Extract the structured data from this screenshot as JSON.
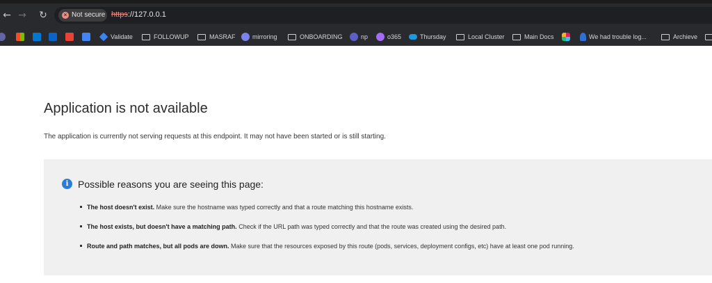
{
  "browser": {
    "security_chip": "Not secure",
    "url_scheme": "https",
    "url_rest": "://127.0.0.1",
    "bookmarks": [
      {
        "label": "",
        "icon": "teams-icon",
        "color": "#6264a7"
      },
      {
        "label": "",
        "icon": "windows-icon",
        "color": "#f25022"
      },
      {
        "label": "",
        "icon": "app-icon",
        "color": "#0078d4"
      },
      {
        "label": "",
        "icon": "outlook-icon",
        "color": "#0a64c8"
      },
      {
        "label": "",
        "icon": "gmail-icon",
        "color": "#ea4335"
      },
      {
        "label": "",
        "icon": "calendar-icon",
        "color": "#4285f4"
      },
      {
        "label": "Validate",
        "icon": "diamond-icon",
        "color": "#3b82f6"
      },
      {
        "label": "FOLLOWUP",
        "icon": "folder-icon",
        "color": ""
      },
      {
        "label": "MASRAF",
        "icon": "folder-icon",
        "color": ""
      },
      {
        "label": "mirroring",
        "icon": "teams-icon",
        "color": "#7b83eb"
      },
      {
        "label": "ONBOARDING",
        "icon": "folder-icon",
        "color": ""
      },
      {
        "label": "np",
        "icon": "teams-icon",
        "color": "#5b5fc7"
      },
      {
        "label": "o365",
        "icon": "copilot-icon",
        "color": "#a46cf5"
      },
      {
        "label": "Thursday",
        "icon": "cloud-icon",
        "color": "#1b98e0"
      },
      {
        "label": "Local Cluster",
        "icon": "folder-icon",
        "color": ""
      },
      {
        "label": "Main Docs",
        "icon": "folder-icon",
        "color": ""
      },
      {
        "label": "",
        "icon": "slack-icon",
        "color": "#e01e5a"
      },
      {
        "label": "We had trouble log...",
        "icon": "person-icon",
        "color": "#2f6fd6"
      },
      {
        "label": "Archieve",
        "icon": "folder-icon",
        "color": ""
      }
    ]
  },
  "page": {
    "title": "Application is not available",
    "description": "The application is currently not serving requests at this endpoint. It may not have been started or is still starting."
  },
  "reasons": {
    "title": "Possible reasons you are seeing this page:",
    "items": [
      {
        "bold": "The host doesn't exist.",
        "text": " Make sure the hostname was typed correctly and that a route matching this hostname exists."
      },
      {
        "bold": "The host exists, but doesn't have a matching path.",
        "text": " Check if the URL path was typed correctly and that the route was created using the desired path."
      },
      {
        "bold": "Route and path matches, but all pods are down.",
        "text": " Make sure that the resources exposed by this route (pods, services, deployment configs, etc) have at least one pod running."
      }
    ]
  }
}
